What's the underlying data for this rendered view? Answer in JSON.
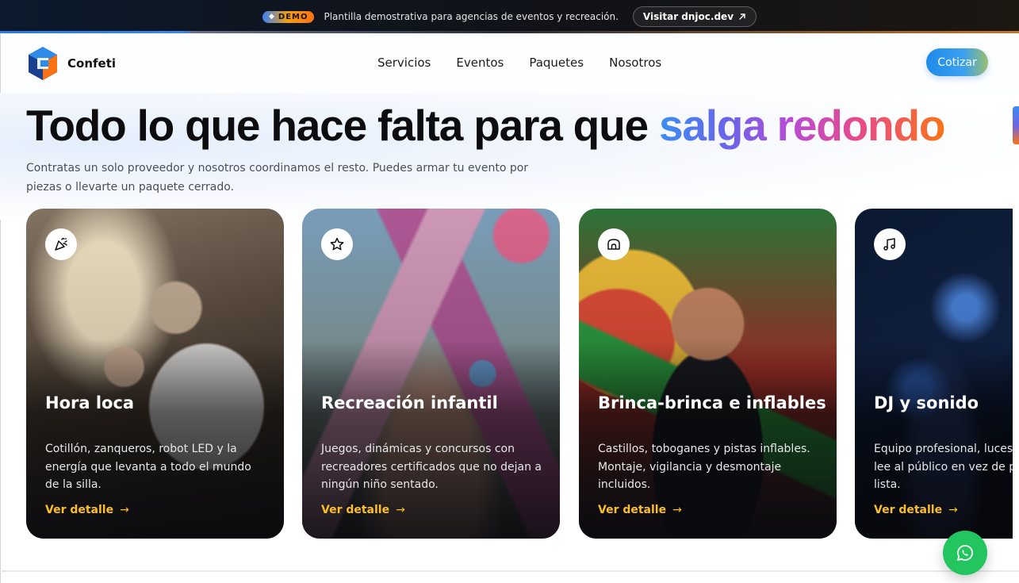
{
  "demo_bar": {
    "badge": "DEMO",
    "text": "Plantilla demostrativa para agencias de eventos y recreación.",
    "visit_label": "Visitar dnjoc.dev",
    "visit_icon": "arrow-up-right-icon"
  },
  "nav": {
    "brand": "Confeti",
    "links": [
      "Servicios",
      "Eventos",
      "Paquetes",
      "Nosotros"
    ],
    "cta": "Cotizar"
  },
  "hero": {
    "title_plain": "Todo lo que hace falta para que ",
    "title_highlight": "salga redondo",
    "subtitle": "Contratas un solo proveedor y nosotros coordinamos el resto. Puedes armar tu evento por piezas o llevarte un paquete cerrado."
  },
  "cards": [
    {
      "icon": "party-popper-icon",
      "title": "Hora loca",
      "description": "Cotillón, zanqueros, robot LED y la energía que levanta a todo el mundo de la silla.",
      "link": "Ver detalle"
    },
    {
      "icon": "star-icon",
      "title": "Recreación infantil",
      "description": "Juegos, dinámicas y concursos con recreadores certificados que no dejan a ningún niño sentado.",
      "link": "Ver detalle"
    },
    {
      "icon": "castle-icon",
      "title": "Brinca-brinca e inflables",
      "description": "Castillos, toboganes y pistas inflables. Montaje, vigilancia y desmontaje incluidos.",
      "link": "Ver detalle"
    },
    {
      "icon": "music-note-icon",
      "title": "DJ y sonido",
      "description": "Equipo profesional, luces lee al público en vez de p lista.",
      "link": "Ver detalle"
    }
  ],
  "floating": {
    "whatsapp_icon": "whatsapp-icon"
  },
  "colors": {
    "accent_blue": "#1f8bea",
    "link_amber": "#fbbf24",
    "whatsapp_green": "#22c55e"
  }
}
